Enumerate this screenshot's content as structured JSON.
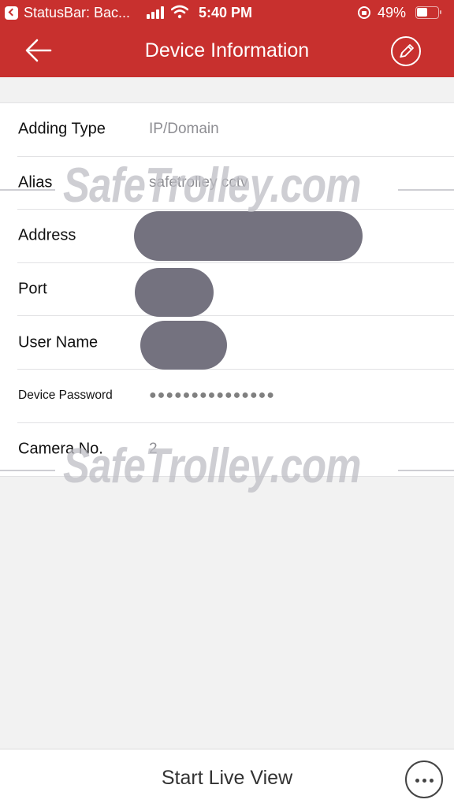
{
  "status_bar": {
    "app_name": "StatusBar: Bac...",
    "time": "5:40 PM",
    "battery_percent": "49%",
    "battery_level": 0.49,
    "signal_bars": 4,
    "icons": [
      "back-to-app-icon",
      "signal-icon",
      "wifi-icon",
      "rotation-lock-icon",
      "battery-icon"
    ]
  },
  "header": {
    "title": "Device Information",
    "back_icon": "arrow-left-icon",
    "edit_icon": "pencil-icon",
    "background_color": "#c8302e"
  },
  "form": {
    "rows": [
      {
        "label": "Adding Type",
        "value": "IP/Domain"
      },
      {
        "label": "Alias",
        "value": "safetrolley cctv"
      },
      {
        "label": "Address",
        "value": "",
        "redacted": true
      },
      {
        "label": "Port",
        "value": "",
        "redacted": true
      },
      {
        "label": "User Name",
        "value": "",
        "redacted": true
      },
      {
        "label": "Device Password",
        "value": "●●●●●●●●●●●●●●●"
      },
      {
        "label": "Camera No.",
        "value": "2"
      }
    ]
  },
  "watermark": {
    "text": "SafeTrolley.com"
  },
  "bottom_bar": {
    "start_live_label": "Start Live View",
    "more_icon": "more-horizontal-icon"
  }
}
